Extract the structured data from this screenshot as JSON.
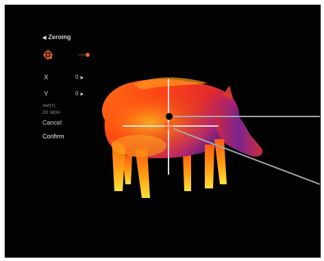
{
  "menu": {
    "title": "Zeroing",
    "toggle_on": true,
    "x_label": "X",
    "x_value": "0",
    "y_label": "Y",
    "y_value": "0",
    "vert_label": "Vert(Y)",
    "zoom_label": "ZO: MOA",
    "cancel_label": "Cancel",
    "confirm_label": "Confirm"
  },
  "colors": {
    "accent": "#e8692c",
    "background": "#020202",
    "crosshair": "#f0f0f0"
  },
  "icons": {
    "back": "chevron-left-icon",
    "reticle": "reticle-icon",
    "value_arrow": "triangle-right-icon"
  }
}
